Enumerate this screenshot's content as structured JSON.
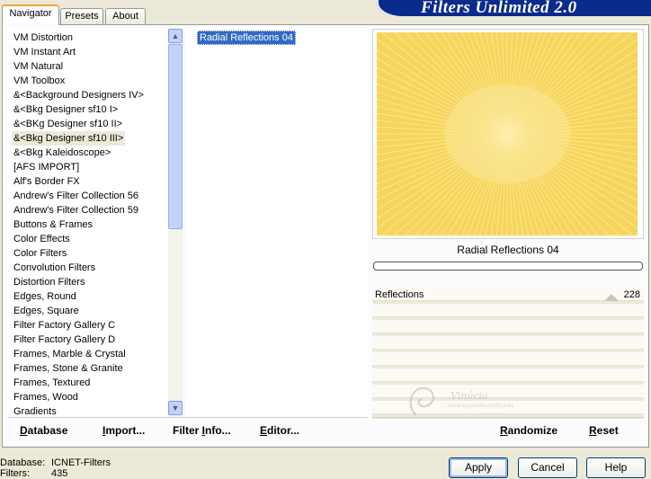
{
  "app": {
    "title": "Filters Unlimited 2.0"
  },
  "tabs": [
    {
      "label": "Navigator",
      "active": true
    },
    {
      "label": "Presets",
      "active": false
    },
    {
      "label": "About",
      "active": false
    }
  ],
  "categories": {
    "items": [
      "VM Distortion",
      "VM Instant Art",
      "VM Natural",
      "VM Toolbox",
      "&<Background Designers IV>",
      "&<Bkg Designer sf10 I>",
      "&<BKg Designer sf10 II>",
      "&<Bkg Designer sf10 III>",
      "&<Bkg Kaleidoscope>",
      "[AFS IMPORT]",
      "Alf's Border FX",
      "Andrew's Filter Collection 56",
      "Andrew's Filter Collection 59",
      "Buttons & Frames",
      "Color Effects",
      "Color Filters",
      "Convolution Filters",
      "Distortion Filters",
      "Edges, Round",
      "Edges, Square",
      "Filter Factory Gallery C",
      "Filter Factory Gallery D",
      "Frames, Marble & Crystal",
      "Frames, Stone & Granite",
      "Frames, Textured",
      "Frames, Wood",
      "Gradients"
    ],
    "selected_index": 7
  },
  "filters": {
    "items": [
      "Radial Reflections 04"
    ],
    "selected_index": 0
  },
  "preview": {
    "filter_name": "Radial Reflections 04",
    "colors": {
      "base": "#f6d55c",
      "ray": "#fff3b8",
      "center": "#fbe9a0"
    }
  },
  "params": [
    {
      "label": "Reflections",
      "value": "228"
    }
  ],
  "toolbar": {
    "database": {
      "hot": "D",
      "rest": "atabase"
    },
    "import": {
      "hot": "I",
      "rest": "mport..."
    },
    "filter_info": {
      "pre": "Filter ",
      "hot": "I",
      "rest": "nfo..."
    },
    "editor": {
      "hot": "E",
      "rest": "ditor..."
    },
    "randomize": {
      "hot": "R",
      "rest": "andomize"
    },
    "reset": {
      "hot": "R",
      "rest": "eset"
    }
  },
  "footer": {
    "database_label": "Database:",
    "database_value": "ICNET-Filters",
    "filters_label": "Filters:",
    "filters_value": "435"
  },
  "dialog_buttons": {
    "apply": "Apply",
    "cancel": "Cancel",
    "help": "Help"
  },
  "watermark": {
    "name": "Vinúcia",
    "site": "www.vaguinhagrafica.es"
  },
  "icons": {
    "scroll_up": "chevron-up-icon",
    "scroll_down": "chevron-down-icon"
  }
}
